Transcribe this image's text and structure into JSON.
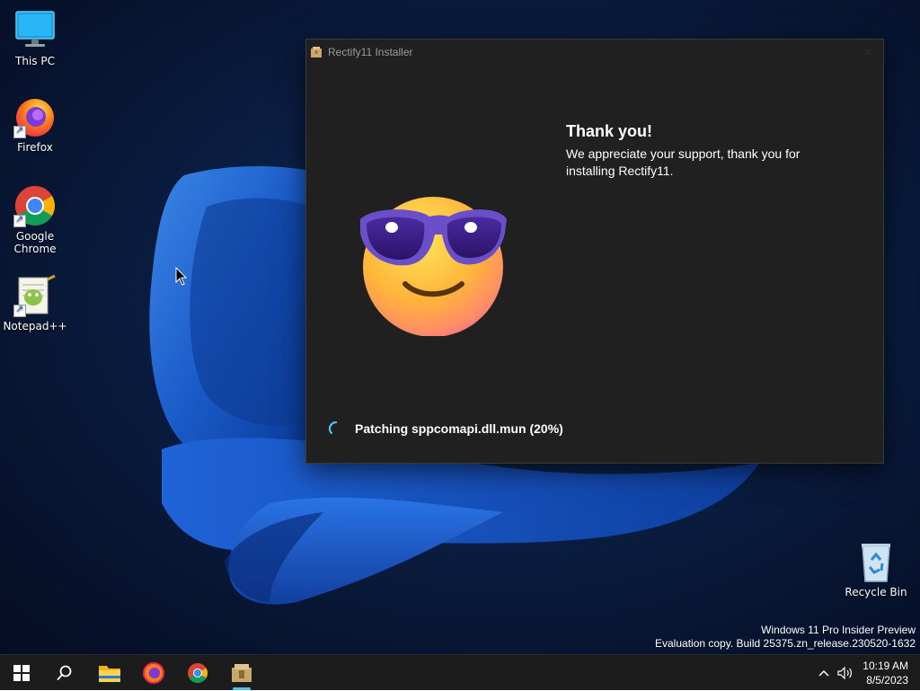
{
  "desktop": {
    "icons": [
      {
        "label": "This PC",
        "icon": "this-pc-icon"
      },
      {
        "label": "Firefox",
        "icon": "firefox-icon"
      },
      {
        "label": "Google Chrome",
        "icon": "chrome-icon"
      },
      {
        "label": "Notepad++",
        "icon": "notepadpp-icon"
      },
      {
        "label": "Recycle Bin",
        "icon": "recycle-bin-icon"
      }
    ],
    "watermark": {
      "line1": "Windows 11 Pro Insider Preview",
      "line2": "Evaluation copy. Build 25375.zn_release.230520-1632"
    }
  },
  "installer": {
    "title": "Rectify11 Installer",
    "heading": "Thank you!",
    "body": "We appreciate your support, thank you for installing Rectify11.",
    "status": "Patching sppcomapi.dll.mun (20%)",
    "progress_percent": 20,
    "emoji": "smiling-face-with-sunglasses"
  },
  "taskbar": {
    "items": [
      "start-icon",
      "search-icon",
      "file-explorer-icon",
      "firefox-icon",
      "chrome-icon",
      "rectify11-installer-icon"
    ],
    "active_item": "rectify11-installer-icon",
    "tray": {
      "time": "10:19 AM",
      "date": "8/5/2023"
    }
  },
  "colors": {
    "accent": "#4cc2ff",
    "window_bg": "#202020",
    "taskbar_bg": "#1c1c1c"
  }
}
